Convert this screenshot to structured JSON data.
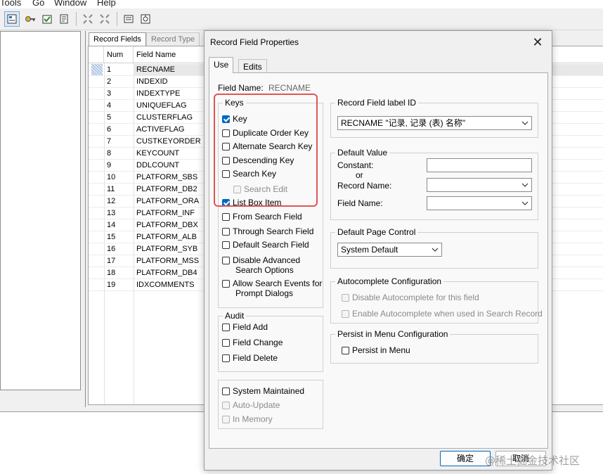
{
  "menubar": {
    "items": [
      "Tools",
      "Go",
      "Window",
      "Help"
    ]
  },
  "toolbar": {
    "icons": [
      "properties-icon",
      "keys-icon",
      "validate-icon",
      "record-icon",
      "collapse-icon",
      "expand-icon",
      "list-icon",
      "settings-icon"
    ]
  },
  "record_window": {
    "tabs": [
      "Record Fields",
      "Record Type"
    ],
    "columns": [
      "Num",
      "Field Name"
    ],
    "rows": [
      {
        "num": "1",
        "name": "RECNAME"
      },
      {
        "num": "2",
        "name": "INDEXID"
      },
      {
        "num": "3",
        "name": "INDEXTYPE"
      },
      {
        "num": "4",
        "name": "UNIQUEFLAG"
      },
      {
        "num": "5",
        "name": "CLUSTERFLAG"
      },
      {
        "num": "6",
        "name": "ACTIVEFLAG"
      },
      {
        "num": "7",
        "name": "CUSTKEYORDER"
      },
      {
        "num": "8",
        "name": "KEYCOUNT"
      },
      {
        "num": "9",
        "name": "DDLCOUNT"
      },
      {
        "num": "10",
        "name": "PLATFORM_SBS"
      },
      {
        "num": "11",
        "name": "PLATFORM_DB2"
      },
      {
        "num": "12",
        "name": "PLATFORM_ORA"
      },
      {
        "num": "13",
        "name": "PLATFORM_INF"
      },
      {
        "num": "14",
        "name": "PLATFORM_DBX"
      },
      {
        "num": "15",
        "name": "PLATFORM_ALB"
      },
      {
        "num": "16",
        "name": "PLATFORM_SYB"
      },
      {
        "num": "17",
        "name": "PLATFORM_MSS"
      },
      {
        "num": "18",
        "name": "PLATFORM_DB4"
      },
      {
        "num": "19",
        "name": "IDXCOMMENTS"
      }
    ]
  },
  "dialog": {
    "title": "Record Field Properties",
    "close": "✕",
    "tabs": [
      "Use",
      "Edits"
    ],
    "field_name_label": "Field Name:",
    "field_name_value": "RECNAME",
    "keys": {
      "legend": "Keys",
      "items": [
        {
          "label": "Key",
          "checked": true,
          "disabled": false
        },
        {
          "label": "Duplicate Order Key",
          "checked": false,
          "disabled": false
        },
        {
          "label": "Alternate Search Key",
          "checked": false,
          "disabled": false
        },
        {
          "label": "Descending Key",
          "checked": false,
          "disabled": false
        },
        {
          "label": "Search Key",
          "checked": false,
          "disabled": false
        },
        {
          "label": "Search Edit",
          "checked": false,
          "disabled": true
        },
        {
          "label": "List Box Item",
          "checked": true,
          "disabled": false
        },
        {
          "label": "From Search Field",
          "checked": false,
          "disabled": false
        },
        {
          "label": "Through Search Field",
          "checked": false,
          "disabled": false
        },
        {
          "label": "Default Search Field",
          "checked": false,
          "disabled": false
        },
        {
          "label": "Disable Advanced",
          "label2": "Search Options",
          "checked": false,
          "disabled": false
        },
        {
          "label": "Allow Search Events for",
          "label2": "Prompt Dialogs",
          "checked": false,
          "disabled": false
        }
      ]
    },
    "audit": {
      "legend": "Audit",
      "items": [
        {
          "label": "Field Add",
          "checked": false
        },
        {
          "label": "Field Change",
          "checked": false
        },
        {
          "label": "Field Delete",
          "checked": false
        }
      ]
    },
    "system": {
      "items": [
        {
          "label": "System Maintained",
          "checked": false,
          "disabled": false
        },
        {
          "label": "Auto-Update",
          "checked": false,
          "disabled": true
        },
        {
          "label": "In Memory",
          "checked": false,
          "disabled": true
        }
      ]
    },
    "label_id": {
      "legend": "Record Field label ID",
      "value": "RECNAME \"记录, 记录 (表) 名称\""
    },
    "default_value": {
      "legend": "Default Value",
      "constant_label": "Constant:",
      "or_label": "or",
      "record_name_label": "Record Name:",
      "field_name_label": "Field Name:"
    },
    "default_page_control": {
      "legend": "Default Page Control",
      "value": "System Default"
    },
    "autocomplete": {
      "legend": "Autocomplete Configuration",
      "items": [
        {
          "label": "Disable Autocomplete for this field",
          "checked": false
        },
        {
          "label": "Enable Autocomplete when used in Search Record",
          "checked": false
        }
      ]
    },
    "persist": {
      "legend": "Persist in Menu Configuration",
      "item": {
        "label": "Persist in Menu",
        "checked": false
      }
    },
    "ok_label": "确定",
    "cancel_label": "取消"
  },
  "watermark": "@稀土掘金技术社区",
  "colors": {
    "highlight": "#e05555",
    "accent": "#0067c0"
  }
}
